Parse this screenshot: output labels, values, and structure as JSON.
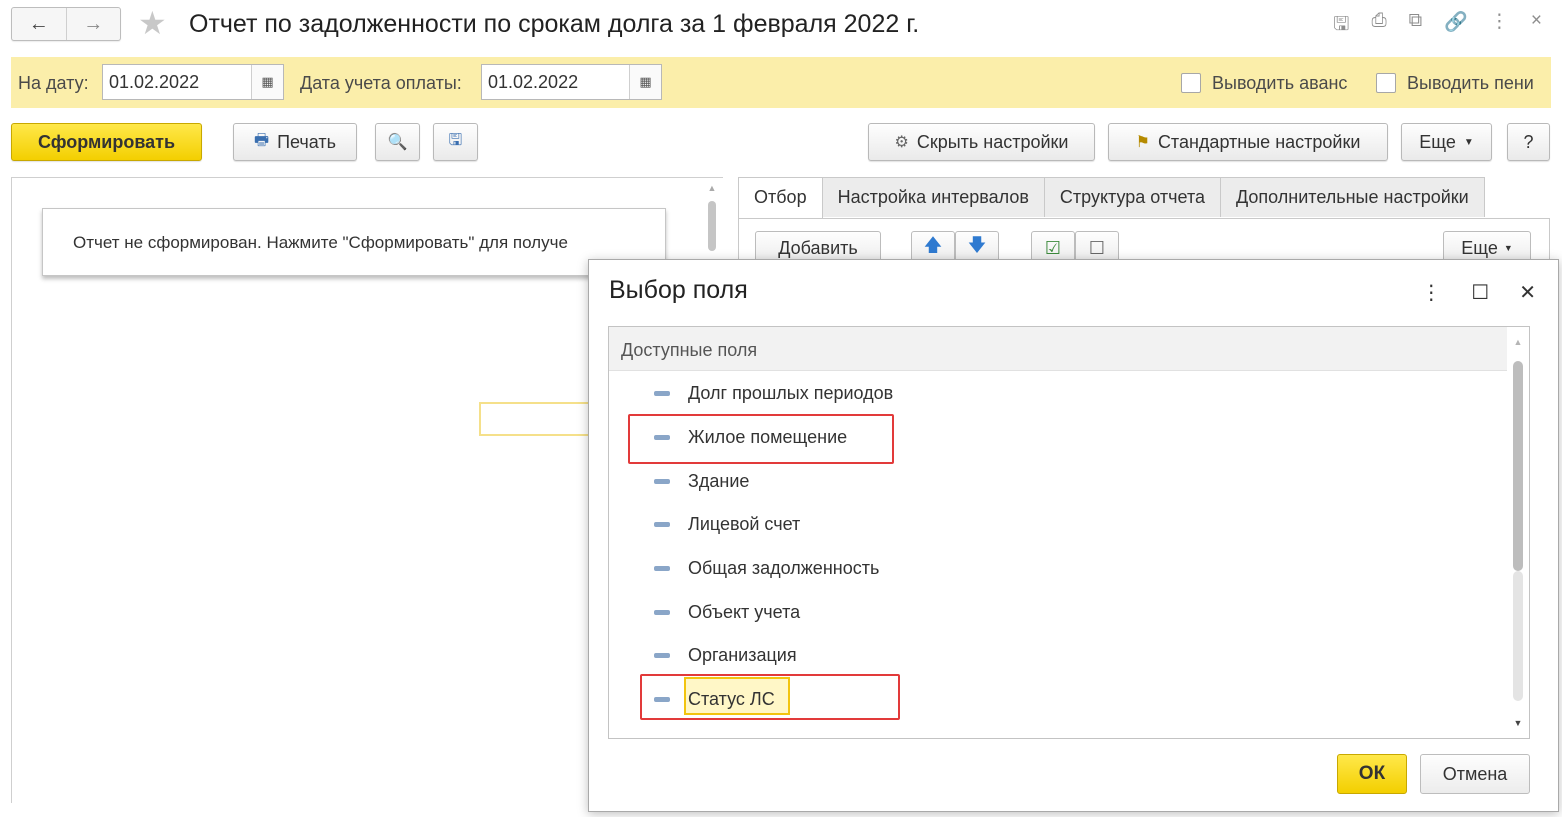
{
  "window": {
    "title": "Отчет по задолженности по срокам долга за 1 февраля 2022 г.",
    "nav_back": "←",
    "nav_forward": "→"
  },
  "params": {
    "date_label": "На дату:",
    "date_value": "01.02.2022",
    "pay_date_label": "Дата учета оплаты:",
    "pay_date_value": "01.02.2022",
    "show_advance_label": "Выводить аванс",
    "show_penalty_label": "Выводить пени"
  },
  "toolbar": {
    "generate": "Сформировать",
    "print": "Печать",
    "hide_settings": "Скрыть настройки",
    "standard_settings": "Стандартные настройки",
    "more": "Еще",
    "help": "?"
  },
  "report": {
    "message": "Отчет не сформирован. Нажмите \"Сформировать\" для получе"
  },
  "settings": {
    "tabs": [
      "Отбор",
      "Настройка интервалов",
      "Структура отчета",
      "Дополнительные настройки"
    ],
    "add_button": "Добавить",
    "more": "Еще"
  },
  "dialog": {
    "title": "Выбор поля",
    "list_header": "Доступные поля",
    "items": [
      "Долг прошлых периодов",
      "Жилое помещение",
      "Здание",
      "Лицевой счет",
      "Общая задолженность",
      "Объект учета",
      "Организация",
      "Статус ЛС"
    ],
    "ok": "ОК",
    "cancel": "Отмена"
  },
  "colors": {
    "accent_yellow": "#f3cf00",
    "param_bar": "#fbeeaa",
    "highlight_red": "#e23a3a"
  }
}
